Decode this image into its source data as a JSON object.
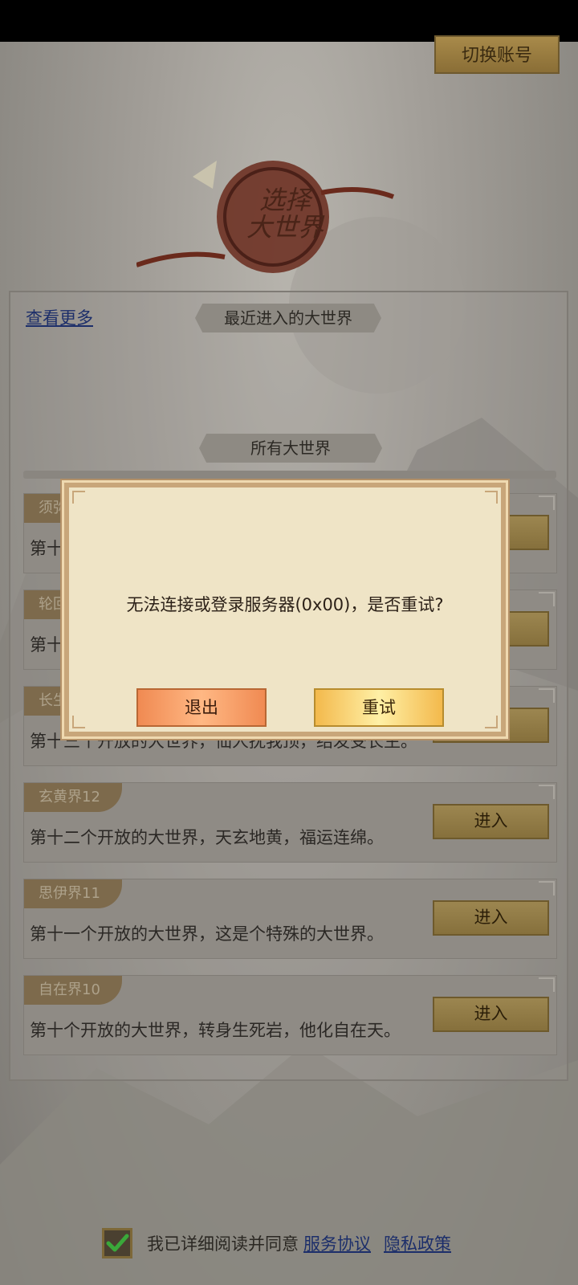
{
  "header": {
    "switch_account": "切换账号"
  },
  "logo": {
    "title_line1": "选择",
    "title_line2": "大世界"
  },
  "panel": {
    "see_more": "查看更多",
    "recent_header": "最近进入的大世界",
    "all_header": "所有大世界"
  },
  "worlds": [
    {
      "tab": "须弥",
      "desc": "第十",
      "enter": "进入"
    },
    {
      "tab": "轮回",
      "desc": "第十",
      "enter": "进入"
    },
    {
      "tab": "长生",
      "desc": "第十三个开放的大世界，仙人抚我顶，结发受长生。",
      "enter": "进入"
    },
    {
      "tab": "玄黄界12",
      "desc": "第十二个开放的大世界，天玄地黄，福运连绵。",
      "enter": "进入"
    },
    {
      "tab": "思伊界11",
      "desc": "第十一个开放的大世界，这是个特殊的大世界。",
      "enter": "进入"
    },
    {
      "tab": "自在界10",
      "desc": "第十个开放的大世界，转身生死岩，他化自在天。",
      "enter": "进入"
    }
  ],
  "dialog": {
    "message": "无法连接或登录服务器(0x00)，是否重试?",
    "exit": "退出",
    "retry": "重试"
  },
  "footer": {
    "agree_text": "我已详细阅读并同意",
    "service_link": "服务协议",
    "privacy_link": "隐私政策",
    "checked": true
  }
}
